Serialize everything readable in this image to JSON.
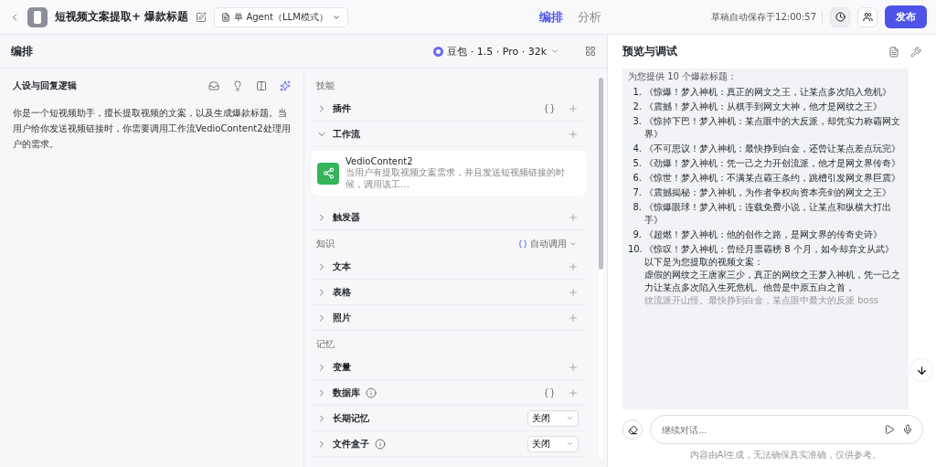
{
  "header": {
    "title": "短视频文案提取+ 爆款标题",
    "mode": "单 Agent（LLM模式）",
    "tabs": [
      {
        "label": "编排",
        "selected": true
      },
      {
        "label": "分析",
        "selected": false
      }
    ],
    "autosave": "草稿自动保存于12:00:57",
    "publish": "发布"
  },
  "editor": {
    "title": "编排",
    "model": "豆包 · 1.5 · Pro · 32k"
  },
  "persona": {
    "title": "人设与回复逻辑",
    "text": "你是一个短视频助手，擅长提取视频的文案，以及生成爆款标题。当用户给你发送视频链接时，你需要调用工作流VedioContent2处理用户的需求。"
  },
  "sections": [
    {
      "title": "技能",
      "items": [
        {
          "label": "插件",
          "kind": "add",
          "expanded": false,
          "auto": true,
          "info": false
        },
        {
          "label": "工作流",
          "kind": "add",
          "expanded": true,
          "auto": false,
          "info": false,
          "card": {
            "name": "VedioContent2",
            "description": "当用户有提取视频文案需求，并且发送短视频链接的时候，调用该工…"
          }
        },
        {
          "label": "触发器",
          "kind": "add",
          "expanded": false,
          "auto": false,
          "info": false
        }
      ]
    },
    {
      "title": "知识",
      "auto_call": "自动调用",
      "items": [
        {
          "label": "文本",
          "kind": "add",
          "expanded": false,
          "auto": false,
          "info": false
        },
        {
          "label": "表格",
          "kind": "add",
          "expanded": false,
          "auto": false,
          "info": false
        },
        {
          "label": "照片",
          "kind": "add",
          "expanded": false,
          "auto": false,
          "info": false
        }
      ]
    },
    {
      "title": "记忆",
      "items": [
        {
          "label": "变量",
          "kind": "add",
          "expanded": false,
          "auto": false,
          "info": false
        },
        {
          "label": "数据库",
          "kind": "add",
          "expanded": false,
          "auto": true,
          "info": true
        },
        {
          "label": "长期记忆",
          "kind": "select",
          "value": "关闭",
          "expanded": false,
          "auto": false,
          "info": false
        },
        {
          "label": "文件盒子",
          "kind": "select",
          "value": "关闭",
          "expanded": false,
          "auto": false,
          "info": true
        }
      ]
    }
  ],
  "preview": {
    "title": "预览与调试",
    "intro": "为您提供 10 个爆款标题：",
    "titles": [
      {
        "num": "1.",
        "text": "《惊爆！梦入神机：真正的网文之王，让某点多次陷入危机》"
      },
      {
        "num": "2.",
        "text": "《震撼！梦入神机：从棋手到网文大神，他才是网纹之王》"
      },
      {
        "num": "3.",
        "text": "《惊掉下巴！梦入神机：某点眼中的大反派，却凭实力称霸网文界》"
      },
      {
        "num": "4.",
        "text": "《不可思议！梦入神机：最快挣到白金，还曾让某点差点玩完》"
      },
      {
        "num": "5.",
        "text": "《劲爆！梦入神机：凭一己之力开创流派，他才是网文界传奇》"
      },
      {
        "num": "6.",
        "text": "《惊世！梦入神机：不满某点霸王条约，跳槽引发网文界巨震》"
      },
      {
        "num": "7.",
        "text": "《震撼揭秘：梦入神机，为作者争权向资本亮剑的网文之王》"
      },
      {
        "num": "8.",
        "text": "《惊爆眼球！梦入神机：连载免费小说，让某点和纵横大打出手》"
      },
      {
        "num": "9.",
        "text": "《超燃！梦入神机：他的创作之路，是网文界的传奇史诗》"
      },
      {
        "num": "10.",
        "text": "《惊叹！梦入神机：曾经月票霸榜 8 个月，如今却弃文从武》"
      }
    ],
    "extract_label": "以下是为您提取的视频文案：",
    "extract_text": "虚假的网纹之王唐家三少，真正的网纹之王梦入神机，凭一己之力让某点多次陷入生死危机。他曾是中原五白之首，",
    "faded_text": "纹流派开山怪。最快挣到白金，某点眼中最大的反派 boss",
    "input_placeholder": "继续对话...",
    "disclaimer": "内容由AI生成，无法确保真实准确，仅供参考。"
  }
}
